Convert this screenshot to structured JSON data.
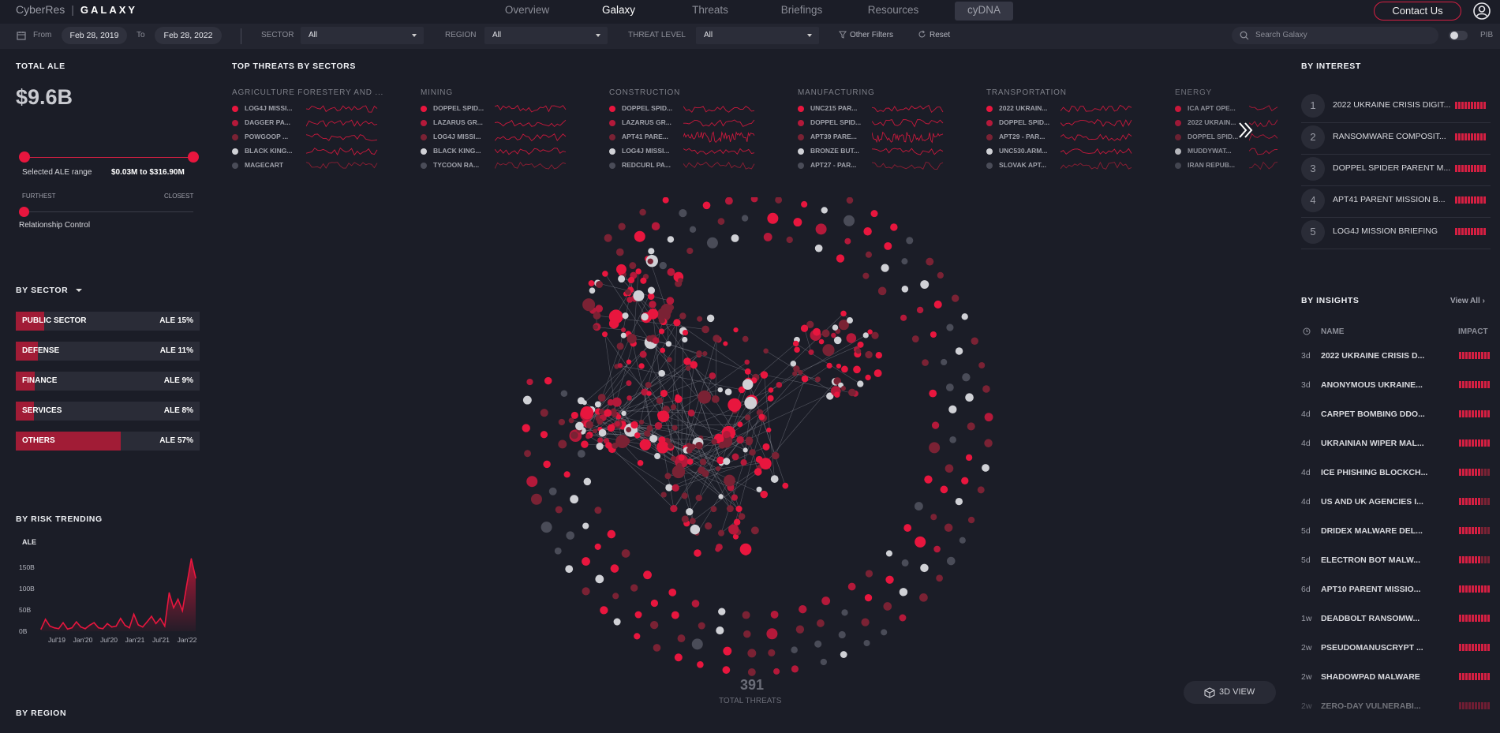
{
  "brand": {
    "company": "CyberRes",
    "product": "GALAXY"
  },
  "nav": {
    "items": [
      "Overview",
      "Galaxy",
      "Threats",
      "Briefings",
      "Resources",
      "cyDNA"
    ],
    "active": "Galaxy",
    "contact_label": "Contact Us"
  },
  "filters": {
    "from_label": "From",
    "from_value": "Feb 28, 2019",
    "to_label": "To",
    "to_value": "Feb 28, 2022",
    "sector_label": "SECTOR",
    "sector_value": "All",
    "region_label": "REGION",
    "region_value": "All",
    "threat_label": "THREAT LEVEL",
    "threat_value": "All",
    "other_filters": "Other Filters",
    "reset": "Reset",
    "search_placeholder": "Search Galaxy",
    "pib_label": "PIB"
  },
  "left": {
    "total_ale_title": "TOTAL ALE",
    "total_ale_value": "$9.6B",
    "selected_range_label": "Selected ALE range",
    "selected_range_value": "$0.03M to $316.90M",
    "furthest_label": "FURTHEST",
    "closest_label": "CLOSEST",
    "relationship_label": "Relationship Control",
    "relationship_level": 0,
    "by_sector_title": "BY  SECTOR",
    "sectors": [
      {
        "name": "PUBLIC SECTOR",
        "label": "ALE 15%",
        "pct": 15
      },
      {
        "name": "DEFENSE",
        "label": "ALE 11%",
        "pct": 11
      },
      {
        "name": "FINANCE",
        "label": "ALE 9%",
        "pct": 9
      },
      {
        "name": "SERVICES",
        "label": "ALE 8%",
        "pct": 8
      },
      {
        "name": "OTHERS",
        "label": "ALE 57%",
        "pct": 57
      }
    ],
    "risk_title": "BY RISK TRENDING",
    "region_title": "BY REGION"
  },
  "chart_data": {
    "type": "area",
    "ylabel": "ALE",
    "y_ticks": [
      "150B",
      "100B",
      "50B",
      "0B"
    ],
    "x_ticks": [
      "Jul'19",
      "Jan'20",
      "Jul'20",
      "Jan'21",
      "Jul'21",
      "Jan'22"
    ],
    "ylim": [
      0,
      200
    ],
    "series": [
      {
        "values": [
          5,
          28,
          12,
          8,
          6,
          20,
          5,
          8,
          22,
          10,
          6,
          14,
          20,
          8,
          6,
          18,
          10,
          12,
          30,
          14,
          8,
          40,
          15,
          10,
          22,
          35,
          18,
          30,
          12,
          90,
          55,
          75,
          48,
          110,
          170,
          125
        ]
      }
    ]
  },
  "center": {
    "top_threats_title": "TOP THREATS BY SECTORS",
    "sectors": [
      {
        "title": "AGRICULTURE FORESTERY AND ...",
        "threats": [
          [
            "LOG4J MISSI...",
            "#e8163e"
          ],
          [
            "DAGGER PA...",
            "#b4193a"
          ],
          [
            "POWGOOP ...",
            "#7a2234"
          ],
          [
            "BLACK KING...",
            "#d0d1d6"
          ],
          [
            "MAGECART",
            "#4a4c58"
          ]
        ]
      },
      {
        "title": "MINING",
        "threats": [
          [
            "DOPPEL SPID...",
            "#e8163e"
          ],
          [
            "LAZARUS GR...",
            "#b4193a"
          ],
          [
            "LOG4J MISSI...",
            "#7a2234"
          ],
          [
            "BLACK KING...",
            "#d0d1d6"
          ],
          [
            "TYCOON RA...",
            "#4a4c58"
          ]
        ]
      },
      {
        "title": "CONSTRUCTION",
        "threats": [
          [
            "DOPPEL SPID...",
            "#e8163e"
          ],
          [
            "LAZARUS GR...",
            "#b4193a"
          ],
          [
            "APT41 PARE...",
            "#7a2234"
          ],
          [
            "LOG4J MISSI...",
            "#d0d1d6"
          ],
          [
            "REDCURL PA...",
            "#4a4c58"
          ]
        ]
      },
      {
        "title": "MANUFACTURING",
        "threats": [
          [
            "UNC215 PAR...",
            "#e8163e"
          ],
          [
            "DOPPEL SPID...",
            "#b4193a"
          ],
          [
            "APT39 PARE...",
            "#7a2234"
          ],
          [
            "BRONZE BUT...",
            "#d0d1d6"
          ],
          [
            "APT27 - PAR...",
            "#4a4c58"
          ]
        ]
      },
      {
        "title": "TRANSPORTATION",
        "threats": [
          [
            "2022 UKRAIN...",
            "#e8163e"
          ],
          [
            "DOPPEL SPID...",
            "#b4193a"
          ],
          [
            "APT29 - PAR...",
            "#7a2234"
          ],
          [
            "UNC530.ARM...",
            "#d0d1d6"
          ],
          [
            "SLOVAK APT...",
            "#4a4c58"
          ]
        ]
      },
      {
        "title": "ENERGY",
        "threats": [
          [
            "ICA APT OPE...",
            "#e8163e"
          ],
          [
            "2022 UKRAIN...",
            "#b4193a"
          ],
          [
            "DOPPEL SPID...",
            "#7a2234"
          ],
          [
            "MUDDYWAT...",
            "#d0d1d6"
          ],
          [
            "IRAN REPUB...",
            "#4a4c58"
          ]
        ]
      }
    ],
    "total_threats_value": "391",
    "total_threats_label": "TOTAL THREATS",
    "view3d_label": "3D VIEW"
  },
  "right": {
    "interest_title": "BY INTEREST",
    "interest": [
      {
        "num": "1",
        "name": "2022 UKRAINE CRISIS DIGIT..."
      },
      {
        "num": "2",
        "name": "RANSOMWARE COMPOSIT..."
      },
      {
        "num": "3",
        "name": "DOPPEL SPIDER PARENT M..."
      },
      {
        "num": "4",
        "name": "APT41 PARENT MISSION B..."
      },
      {
        "num": "5",
        "name": "LOG4J MISSION BRIEFING"
      }
    ],
    "insights_title": "BY INSIGHTS",
    "view_all": "View All",
    "col_name": "NAME",
    "col_impact": "IMPACT",
    "insights": [
      {
        "age": "3d",
        "name": "2022 UKRAINE CRISIS D...",
        "impact": 10
      },
      {
        "age": "3d",
        "name": "ANONYMOUS UKRAINE...",
        "impact": 10
      },
      {
        "age": "4d",
        "name": "CARPET BOMBING DDO...",
        "impact": 10
      },
      {
        "age": "4d",
        "name": "UKRAINIAN WIPER MAL...",
        "impact": 10
      },
      {
        "age": "4d",
        "name": "ICE PHISHING BLOCKCH...",
        "impact": 7
      },
      {
        "age": "4d",
        "name": "US AND UK AGENCIES I...",
        "impact": 7
      },
      {
        "age": "5d",
        "name": "DRIDEX MALWARE DEL...",
        "impact": 7
      },
      {
        "age": "5d",
        "name": "ELECTRON BOT MALW...",
        "impact": 7
      },
      {
        "age": "6d",
        "name": "APT10 PARENT MISSIO...",
        "impact": 10
      },
      {
        "age": "1w",
        "name": "DEADBOLT RANSOMW...",
        "impact": 10
      },
      {
        "age": "2w",
        "name": "PSEUDOMANUSCRYPT ...",
        "impact": 10
      },
      {
        "age": "2w",
        "name": "SHADOWPAD MALWARE",
        "impact": 10
      },
      {
        "age": "2w",
        "name": "ZERO-DAY VULNERABI...",
        "impact": 10
      }
    ]
  },
  "colors": {
    "accent": "#e8163e",
    "accent_dark": "#7a2234",
    "node_light": "#d0d1d6",
    "node_dim": "#4a4c58",
    "bg": "#1b1d27"
  }
}
